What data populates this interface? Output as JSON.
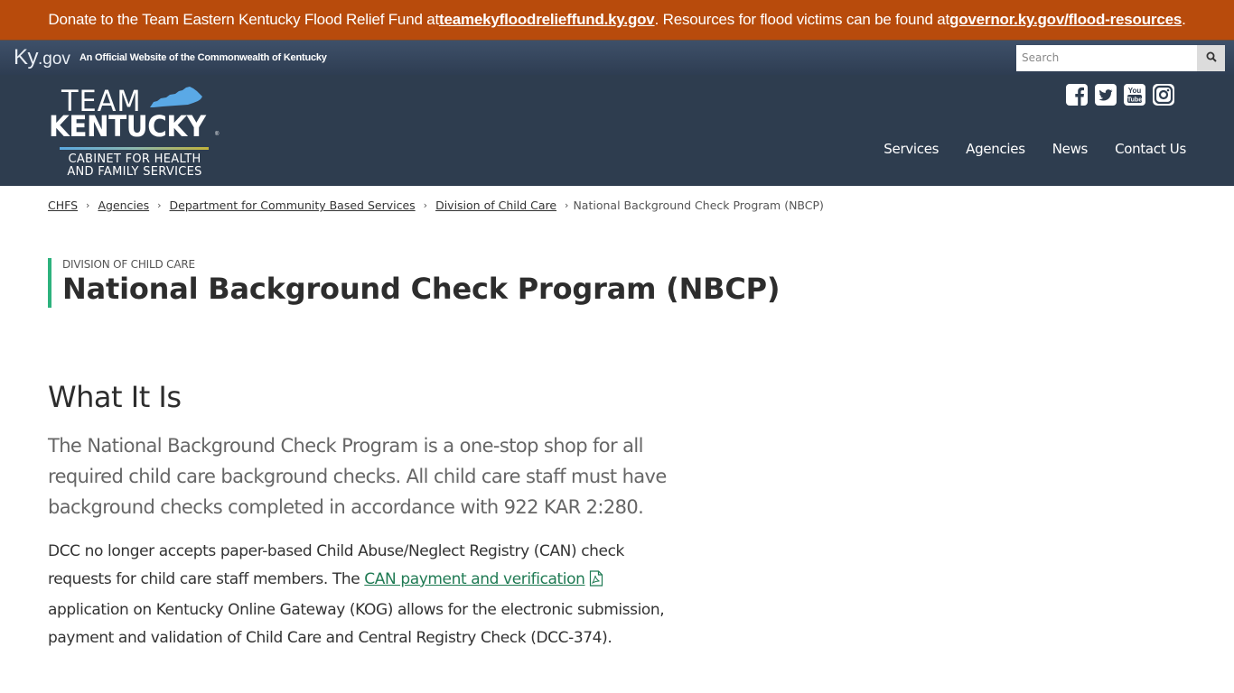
{
  "alert": {
    "text_before": "Donate to the Team Eastern Kentucky Flood Relief Fund at ",
    "link1": "teamekyfloodrelieffund.ky.gov",
    "text_middle": ". Resources for flood victims can be found at ",
    "link2": "governor.ky.gov/flood-resources",
    "text_after": "."
  },
  "kygov": {
    "logo_ky": "Ky",
    "logo_gov": ".gov",
    "tagline": "An Official Website of the Commonwealth of Kentucky",
    "search_placeholder": "Search",
    "search_icon": "search-icon"
  },
  "header": {
    "logo_team": "TEAM",
    "logo_kentucky": "KENTUCKY",
    "logo_reg": "®",
    "logo_cabinet_line1": "CABINET FOR HEALTH",
    "logo_cabinet_line2": "AND FAMILY SERVICES",
    "social": [
      "facebook-icon",
      "twitter-icon",
      "youtube-icon",
      "instagram-icon"
    ],
    "nav": [
      "Services",
      "Agencies",
      "News",
      "Contact Us"
    ]
  },
  "breadcrumb": {
    "items": [
      "CHFS",
      "Agencies",
      "Department for Community Based Services",
      "Division of Child Care"
    ],
    "current": "National Background Check Program (NBCP)"
  },
  "title": {
    "eyebrow": "DIVISION OF CHILD CARE",
    "heading": "National Background Check Program (NBCP)"
  },
  "content": {
    "section_heading": "What It Is",
    "lead": "The National Background Check Program is a one-stop shop for all required child care background checks. All child care staff must have background checks completed in accordance with 922 KAR 2:280.",
    "body_before": "DCC no longer accepts paper-based Child Abuse/Neglect Registry (CAN) check requests for child care staff members. The ",
    "body_link": "CAN payment and verification",
    "body_after": " application on Kentucky Online Gateway (KOG) allows for the electronic submission, payment and validation of Child Care and Central Registry Check (DCC-374)."
  },
  "colors": {
    "alert_bg": "#b84b0c",
    "header_bg": "#2e3d4f",
    "accent_green": "#2db27d",
    "link_green": "#1f7a53"
  }
}
